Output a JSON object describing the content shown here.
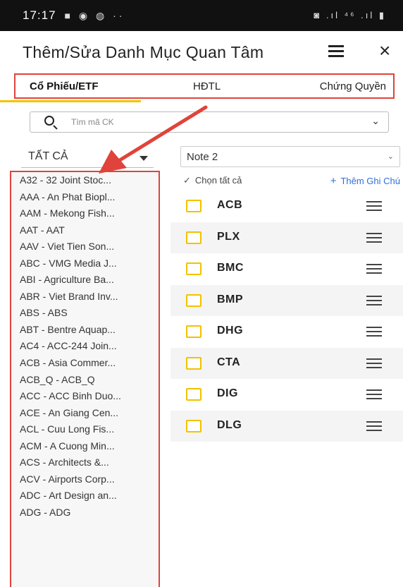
{
  "status_bar": {
    "time": "17:17",
    "left_icons": "■ ◉ ◍ ··",
    "right_icons": "◙ .ıl ⁴⁶ .ıl ▮"
  },
  "header": {
    "title": "Thêm/Sửa Danh Mục Quan Tâm",
    "list_icon": "list-icon",
    "close_icon": "×"
  },
  "tabs": [
    {
      "label": "Cổ Phiếu/ETF",
      "active": true
    },
    {
      "label": "HĐTL",
      "active": false
    },
    {
      "label": "Chứng Quyền",
      "active": false
    }
  ],
  "search": {
    "placeholder": "Tìm mã CK",
    "chevron": "⌄"
  },
  "filter": {
    "selected": "TẤT CẢ"
  },
  "stock_list": [
    "A32 - 32 Joint Stoc...",
    "AAA - An Phat Biopl...",
    "AAM - Mekong Fish...",
    "AAT - AAT",
    "AAV - Viet Tien Son...",
    "ABC - VMG Media J...",
    "ABI - Agriculture Ba...",
    "ABR - Viet Brand Inv...",
    "ABS - ABS",
    "ABT - Bentre Aquap...",
    "AC4 - ACC-244 Join...",
    "ACB - Asia Commer...",
    "ACB_Q - ACB_Q",
    "ACC - ACC Binh Duo...",
    "ACE - An Giang Cen...",
    "ACL - Cuu Long Fis...",
    "ACM - A Cuong Min...",
    "ACS - Architects &...",
    "ACV - Airports Corp...",
    "ADC - Art Design an...",
    "ADG - ADG"
  ],
  "note": {
    "selected": "Note 2",
    "chevron": "⌄"
  },
  "actions": {
    "select_all": "Chọn tất cả",
    "add_note": "Thêm Ghi Chú"
  },
  "watchlist": [
    "ACB",
    "PLX",
    "BMC",
    "BMP",
    "DHG",
    "CTA",
    "DIG",
    "DLG"
  ],
  "colors": {
    "highlight_border": "#e0433b",
    "tab_underline": "#f0c400",
    "checkbox": "#f2c200",
    "link": "#2f6fdc",
    "arrow": "#e0433b"
  }
}
